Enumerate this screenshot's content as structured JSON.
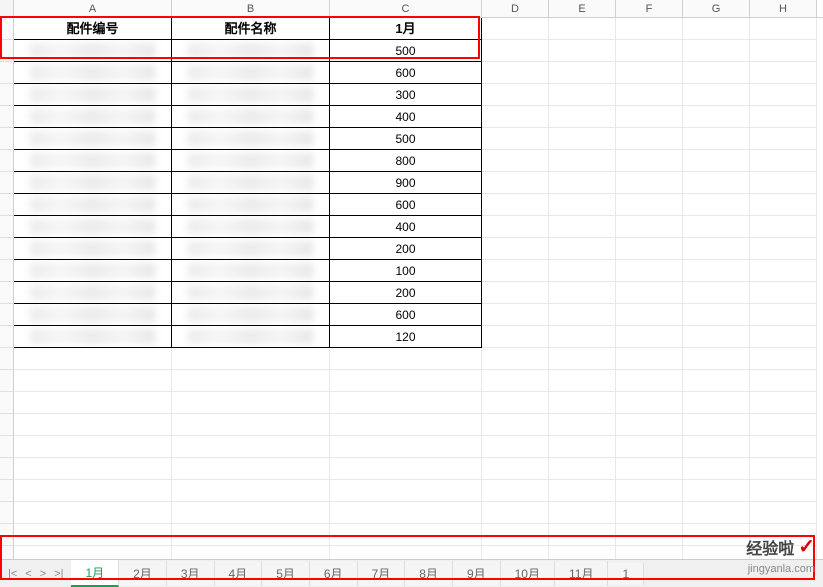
{
  "columns": [
    "A",
    "B",
    "C",
    "D",
    "E",
    "F",
    "G",
    "H"
  ],
  "headers": {
    "col_a": "配件编号",
    "col_b": "配件名称",
    "col_c": "1月"
  },
  "data_rows": [
    {
      "c": "500"
    },
    {
      "c": "600"
    },
    {
      "c": "300"
    },
    {
      "c": "400"
    },
    {
      "c": "500"
    },
    {
      "c": "800"
    },
    {
      "c": "900"
    },
    {
      "c": "600"
    },
    {
      "c": "400"
    },
    {
      "c": "200"
    },
    {
      "c": "100"
    },
    {
      "c": "200"
    },
    {
      "c": "600"
    },
    {
      "c": "120"
    }
  ],
  "sheet_tabs": [
    "1月",
    "2月",
    "3月",
    "4月",
    "5月",
    "6月",
    "7月",
    "8月",
    "9月",
    "10月",
    "11月",
    "1"
  ],
  "active_tab": "1月",
  "watermark": {
    "text": "经验啦",
    "sub": "jingyanla.com"
  }
}
